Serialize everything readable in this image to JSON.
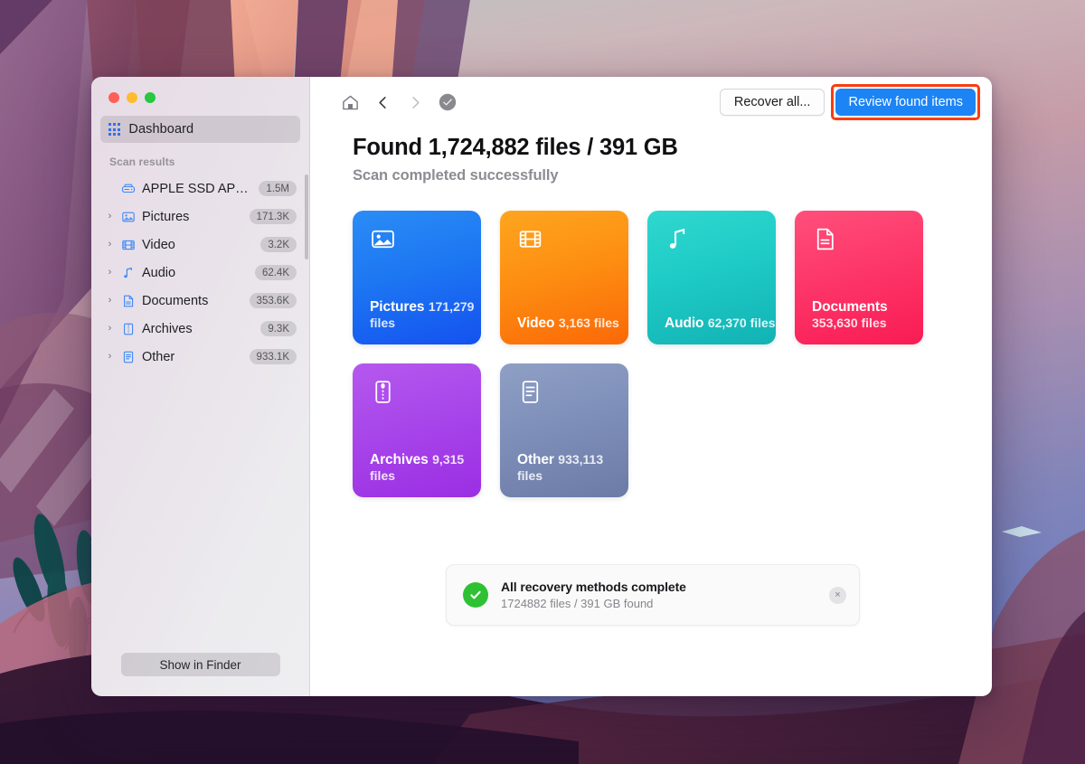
{
  "window": {
    "traffic_lights": [
      {
        "name": "close",
        "color": "#ff5f57"
      },
      {
        "name": "minimize",
        "color": "#febc2e"
      },
      {
        "name": "zoom",
        "color": "#28c840"
      }
    ]
  },
  "sidebar": {
    "dashboard": {
      "label": "Dashboard",
      "icon": "grid-icon",
      "selected": true
    },
    "section_title": "Scan results",
    "items": [
      {
        "label": "APPLE SSD AP0...",
        "count": "1.5M",
        "icon": "drive-icon",
        "expandable": false
      },
      {
        "label": "Pictures",
        "count": "171.3K",
        "icon": "picture-icon",
        "expandable": true
      },
      {
        "label": "Video",
        "count": "3.2K",
        "icon": "film-icon",
        "expandable": true
      },
      {
        "label": "Audio",
        "count": "62.4K",
        "icon": "music-note-icon",
        "expandable": true
      },
      {
        "label": "Documents",
        "count": "353.6K",
        "icon": "document-icon",
        "expandable": true
      },
      {
        "label": "Archives",
        "count": "9.3K",
        "icon": "archive-icon",
        "expandable": true
      },
      {
        "label": "Other",
        "count": "933.1K",
        "icon": "list-doc-icon",
        "expandable": true
      }
    ],
    "footer_button": "Show in Finder"
  },
  "toolbar": {
    "home_icon": "home-icon",
    "back_icon": "chevron-left-icon",
    "forward_icon": "chevron-right-icon",
    "status_icon": "check-circle-icon",
    "recover_all_label": "Recover all...",
    "review_found_label": "Review found items",
    "accent_color": "#1c84f5",
    "highlight_color": "#fa3c11"
  },
  "main": {
    "headline": "Found 1,724,882 files / 391 GB",
    "subhead": "Scan completed successfully",
    "cards": [
      {
        "title": "Pictures",
        "count": "171,279 files",
        "icon": "picture-icon",
        "class": "c-pictures",
        "color": "#1d77f2"
      },
      {
        "title": "Video",
        "count": "3,163 files",
        "icon": "film-icon",
        "class": "c-video",
        "color": "#fd8f12"
      },
      {
        "title": "Audio",
        "count": "62,370 files",
        "icon": "music-note-icon",
        "class": "c-audio",
        "color": "#1ecbc6"
      },
      {
        "title": "Documents",
        "count": "353,630 files",
        "icon": "document-icon",
        "class": "c-documents",
        "color": "#fd3769"
      },
      {
        "title": "Archives",
        "count": "9,315 files",
        "icon": "archive-icon",
        "class": "c-archives",
        "color": "#a846ea"
      },
      {
        "title": "Other",
        "count": "933,113 files",
        "icon": "list-doc-icon",
        "class": "c-other",
        "color": "#7e8fba"
      }
    ]
  },
  "toast": {
    "icon": "check-circle-filled-icon",
    "title": "All recovery methods complete",
    "subtitle": "1724882 files / 391 GB found",
    "close_label": "×",
    "success_color": "#2fc133"
  }
}
